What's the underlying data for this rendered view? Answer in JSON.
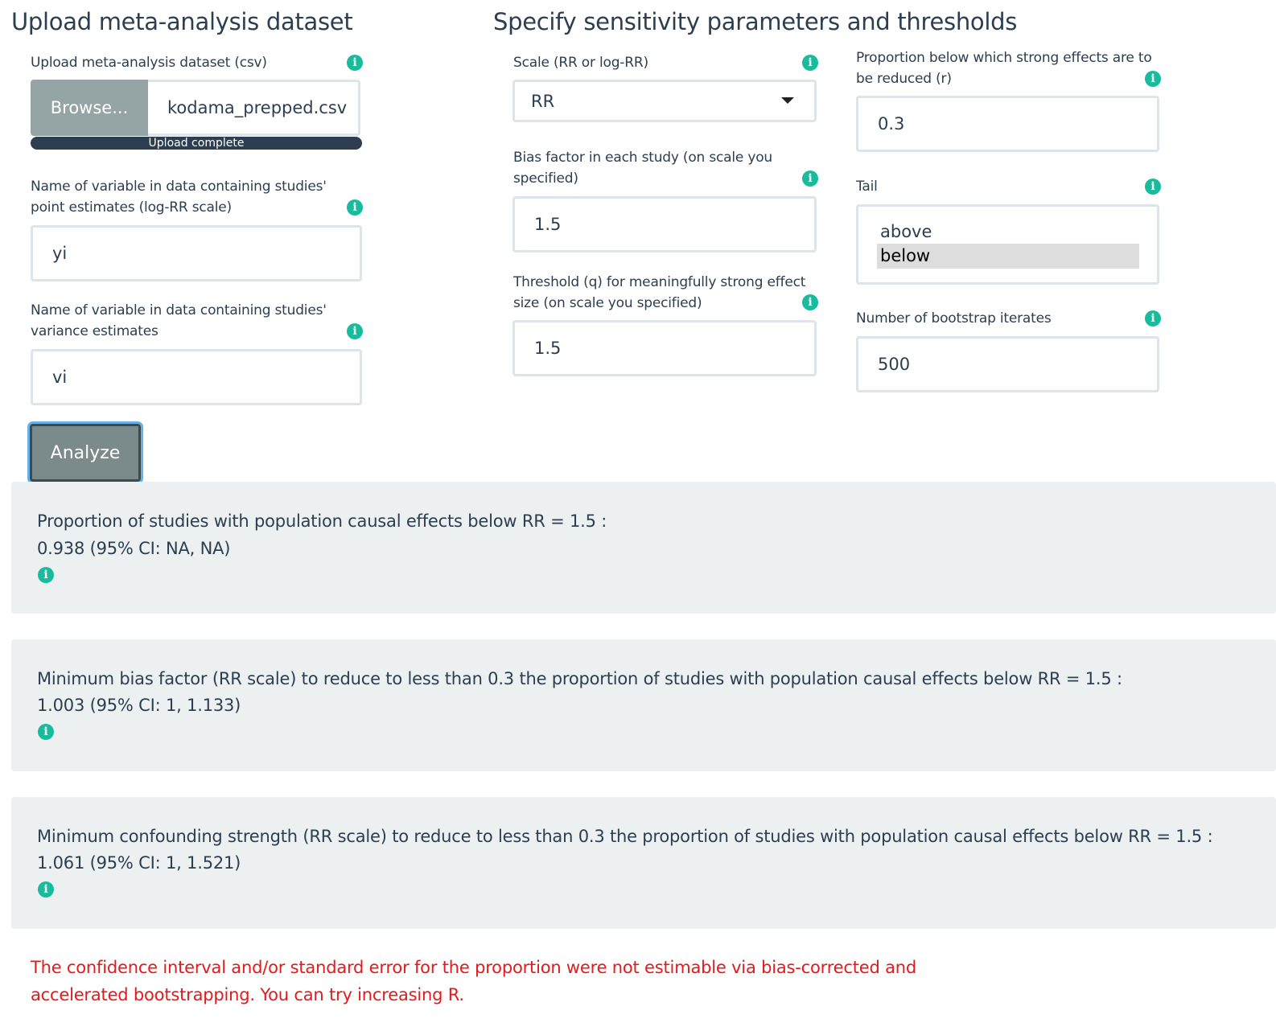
{
  "left": {
    "heading": "Upload meta-analysis dataset",
    "upload_label": "Upload meta-analysis dataset (csv)",
    "browse_label": "Browse...",
    "file_name": "kodama_prepped.csv",
    "progress_text": "Upload complete",
    "progress_value": 1.0,
    "yi_label": "Name of variable in data containing studies' point estimates (log-RR scale)",
    "yi_value": "yi",
    "vi_label": "Name of variable in data containing studies' variance estimates",
    "vi_value": "vi",
    "analyze_label": "Analyze"
  },
  "params": {
    "heading": "Specify sensitivity parameters and thresholds",
    "scale_label": "Scale (RR or log-RR)",
    "scale_value": "RR",
    "bias_label": "Bias factor in each study (on scale you specified)",
    "bias_value": "1.5",
    "q_label": "Threshold (q) for meaningfully strong effect size (on scale you specified)",
    "q_value": "1.5",
    "r_label": "Proportion below which strong effects are to be reduced (r)",
    "r_value": "0.3",
    "tail_label": "Tail",
    "tail_options": [
      "above",
      "below"
    ],
    "tail_selected": "below",
    "boot_label": "Number of bootstrap iterates",
    "boot_value": "500"
  },
  "results": [
    {
      "line1": "Proportion of studies with population causal effects below RR = 1.5 :",
      "line2": "0.938 (95% CI: NA, NA)"
    },
    {
      "line1": "Minimum bias factor (RR scale) to reduce to less than 0.3 the proportion of studies with population causal effects below RR = 1.5 :",
      "line2": "1.003 (95% CI: 1, 1.133)"
    },
    {
      "line1": "Minimum confounding strength (RR scale) to reduce to less than 0.3 the proportion of studies with population causal effects below RR = 1.5 :",
      "line2": "1.061 (95% CI: 1, 1.521)"
    }
  ],
  "error_message": "The confidence interval and/or standard error for the proportion were not estimable via bias-corrected and accelerated bootstrapping. You can try increasing R.",
  "info_glyph": "i",
  "colors": {
    "accent": "#18bc9c",
    "primary": "#2c3e50",
    "error": "#e31a1c",
    "well": "#ecf0f1"
  }
}
